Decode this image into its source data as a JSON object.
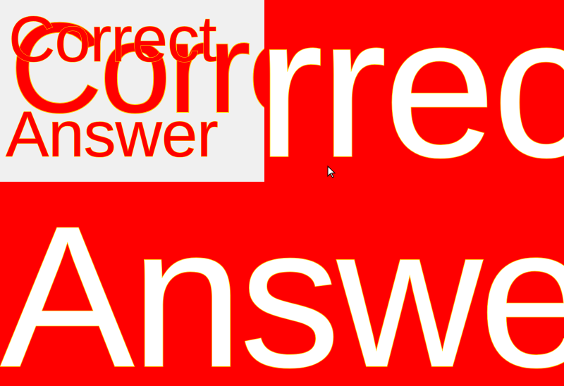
{
  "colors": {
    "background": "#ff0000",
    "panel": "#f0f0f0",
    "primary_text": "#ffffff",
    "panel_text": "#ff0000",
    "outline": "#ffd400"
  },
  "main": {
    "correct_label": "Correct",
    "answer_label": "Answer"
  },
  "panel": {
    "large_correct_label": "Correct",
    "small_correct_label": "Correct",
    "small_answer_label": "Answer"
  },
  "icons": {
    "cursor": "mouse-pointer-icon"
  }
}
